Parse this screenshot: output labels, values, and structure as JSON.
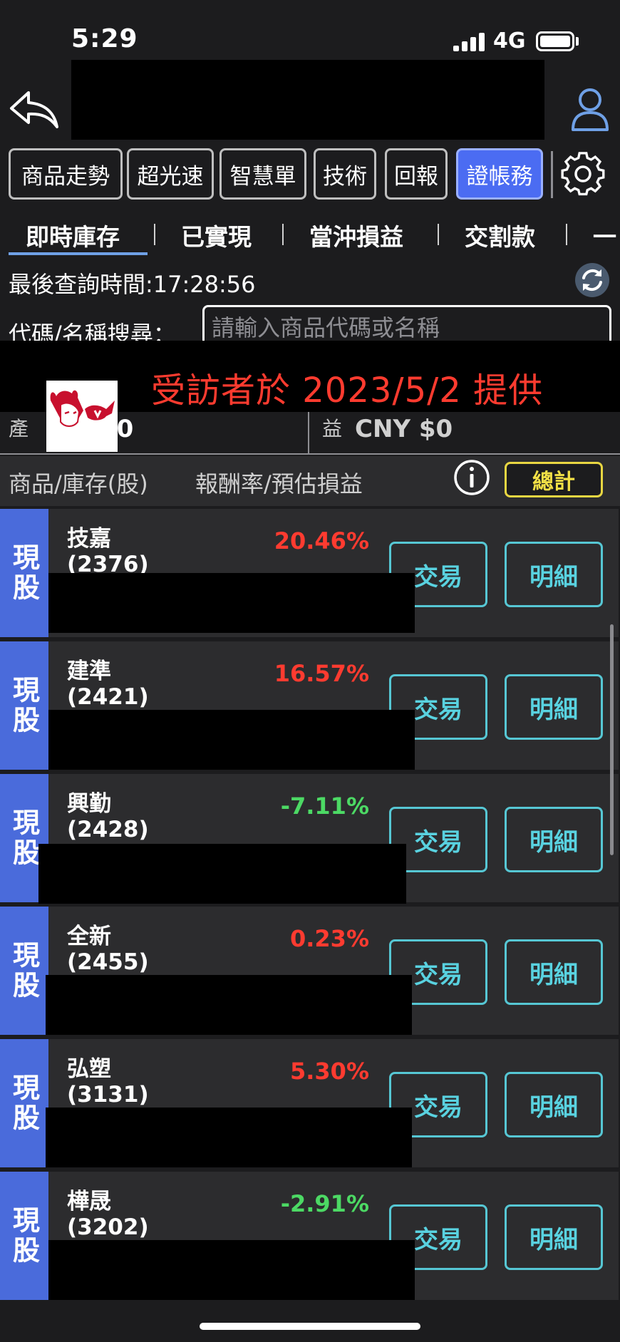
{
  "status_bar": {
    "time": "5:29",
    "network": "4G"
  },
  "header": {
    "back_icon": "back-arrow-icon",
    "user_icon": "user-profile-icon"
  },
  "toolbar": {
    "buttons": [
      {
        "label": "商品走勢",
        "active": false
      },
      {
        "label": "超光速",
        "active": false
      },
      {
        "label": "智慧單",
        "active": false
      },
      {
        "label": "技術",
        "active": false
      },
      {
        "label": "回報",
        "active": false
      },
      {
        "label": "證帳務",
        "active": true
      }
    ],
    "settings_icon": "gear-icon",
    "active_color": "#4b6cf2"
  },
  "tabs": [
    {
      "label": "即時庫存",
      "selected": true
    },
    {
      "label": "已實現",
      "selected": false
    },
    {
      "label": "當沖損益",
      "selected": false
    },
    {
      "label": "交割款",
      "selected": false
    },
    {
      "label": "一",
      "selected": false
    }
  ],
  "query": {
    "last_query_time": "最後查詢時間:17:28:56",
    "refresh_icon": "refresh-icon"
  },
  "search": {
    "label": "代碼/名稱搜尋：",
    "placeholder": "請輸入商品代碼或名稱",
    "value": ""
  },
  "watermark": {
    "text": "受訪者於 2023/5/2 提供"
  },
  "summary": {
    "left_label": "產",
    "left_value": "$0",
    "right_label": "益",
    "right_value": "CNY $0"
  },
  "column_header": {
    "product": "商品/庫存(股)",
    "rate": "報酬率/預估損益",
    "info_icon": "info-icon",
    "total_button": "總計"
  },
  "holdings": [
    {
      "type": "現股",
      "name": "技嘉",
      "code": "(2376)",
      "rate": "20.46%",
      "trend": "up"
    },
    {
      "type": "現股",
      "name": "建準",
      "code": "(2421)",
      "rate": "16.57%",
      "trend": "up"
    },
    {
      "type": "現股",
      "name": "興勤",
      "code": "(2428)",
      "rate": "-7.11%",
      "trend": "down"
    },
    {
      "type": "現股",
      "name": "全新",
      "code": "(2455)",
      "rate": "0.23%",
      "trend": "up"
    },
    {
      "type": "現股",
      "name": "弘塑",
      "code": "(3131)",
      "rate": "5.30%",
      "trend": "up"
    },
    {
      "type": "現股",
      "name": "樺晟",
      "code": "(3202)",
      "rate": "-2.91%",
      "trend": "down"
    }
  ],
  "row_buttons": {
    "trade": "交易",
    "detail": "明細"
  },
  "colors": {
    "positive": "#ff3b30",
    "negative": "#4cd964",
    "tag_bg": "#4a6bdb",
    "row_button": "#56c7d4"
  }
}
